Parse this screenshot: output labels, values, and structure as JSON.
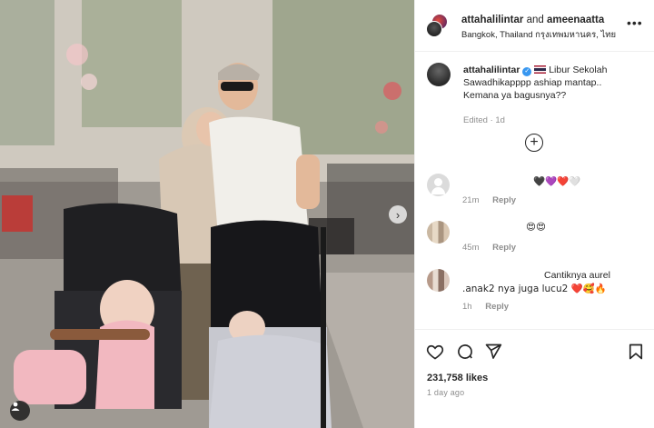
{
  "post": {
    "authors_label": "attahalilintar and ameenaatta",
    "author_primary": "attahalilintar",
    "author_secondary": "ameenaatta",
    "joiner": "and",
    "location": "Bangkok, Thailand กรุงเทพมหานคร, ไทย",
    "more_icon": "more-horizontal-icon"
  },
  "caption": {
    "username": "attahalilintar",
    "text_line1": "Libur Sekolah",
    "text_line2": "Sawadhikapppp ashiap mantap..",
    "text_line3": "Kemana ya bagusnya??",
    "edited": "Edited",
    "age": "1d"
  },
  "comments": [
    {
      "text": "🖤💜❤️🤍",
      "age": "21m",
      "reply": "Reply",
      "avatar": "default"
    },
    {
      "text": "😍😍",
      "age": "45m",
      "reply": "Reply",
      "avatar": "photo"
    },
    {
      "text_line1": "Cantiknya aurel",
      "text_line2": ".anak2 nya juga lucu2 ❤️🥰🔥",
      "age": "1h",
      "reply": "Reply",
      "avatar": "photo"
    }
  ],
  "load_more_label": "+",
  "actions": {
    "icons": [
      "heart-icon",
      "comment-icon",
      "share-icon",
      "bookmark-icon"
    ],
    "likes": "231,758 likes",
    "time": "1 day ago"
  },
  "photo": {
    "next_icon": "chevron-right-icon",
    "tag_icon": "user-tag-icon"
  },
  "colors": {
    "text": "#262626",
    "secondary": "#8e8e8e",
    "verified": "#3897f0",
    "border": "#efefef"
  }
}
